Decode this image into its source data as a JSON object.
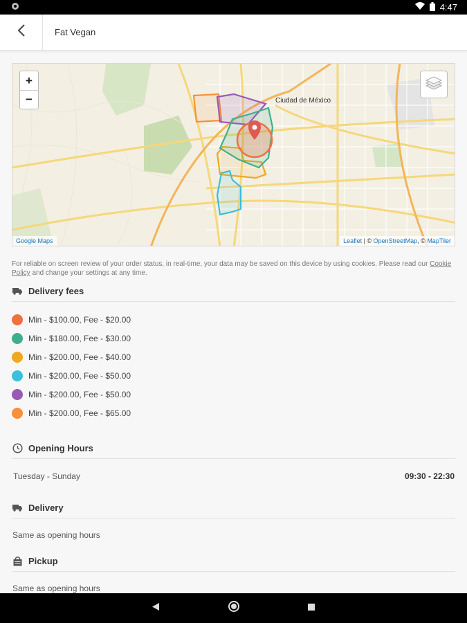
{
  "status_bar": {
    "time": "4:47"
  },
  "header": {
    "title": "Fat Vegan",
    "back_icon": "chevron-left-icon"
  },
  "map": {
    "zoom_in": "+",
    "zoom_out": "−",
    "city_label": "Ciudad de México",
    "attribution_left": "Google Maps",
    "attribution_leaflet": "Leaflet",
    "attribution_sep1": " | © ",
    "attribution_osm": "OpenStreetMap",
    "attribution_sep2": ", © ",
    "attribution_maptiler": "MapTiler"
  },
  "cookie": {
    "text_before": "For reliable on screen review of your order status, in real-time, your data may be saved on this device by using cookies. Please read our ",
    "link": "Cookie Policy",
    "text_after": " and change your settings at any time."
  },
  "delivery_fees": {
    "title": "Delivery fees",
    "items": [
      {
        "label": "Min - $100.00, Fee - $20.00",
        "color": "#f07040"
      },
      {
        "label": "Min - $180.00, Fee - $30.00",
        "color": "#3fae8f"
      },
      {
        "label": "Min - $200.00, Fee - $40.00",
        "color": "#f0a820"
      },
      {
        "label": "Min - $200.00, Fee - $50.00",
        "color": "#3bbfdc"
      },
      {
        "label": "Min - $200.00, Fee - $50.00",
        "color": "#9b59b6"
      },
      {
        "label": "Min - $200.00, Fee - $65.00",
        "color": "#f5913c"
      }
    ]
  },
  "opening_hours": {
    "title": "Opening Hours",
    "days": "Tuesday - Sunday",
    "hours": "09:30 - 22:30"
  },
  "delivery": {
    "title": "Delivery",
    "text": "Same as opening hours"
  },
  "pickup": {
    "title": "Pickup",
    "text": "Same as opening hours"
  },
  "colors": {
    "accent": "#e05a4f"
  }
}
